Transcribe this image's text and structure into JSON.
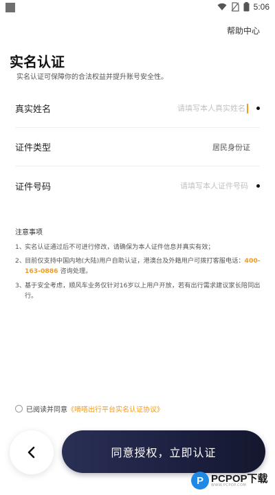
{
  "status_bar": {
    "time": "5:06"
  },
  "header": {
    "help": "帮助中心"
  },
  "page": {
    "title": "实名认证",
    "subtitle": "实名认证可保障你的合法权益并提升账号安全性。"
  },
  "form": {
    "name": {
      "label": "真实姓名",
      "placeholder": "请填写本人真实姓名",
      "value": ""
    },
    "id_type": {
      "label": "证件类型",
      "value": "居民身份证"
    },
    "id_number": {
      "label": "证件号码",
      "placeholder": "请填写本人证件号码",
      "value": ""
    }
  },
  "notice": {
    "title": "注意事项",
    "items": [
      {
        "num": "1、",
        "text": "实名认证通过后不可进行修改，请确保为本人证件信息并真实有效；"
      },
      {
        "num": "2、",
        "text_before": "目前仅支持中国内地(大陆)用户自助认证，港澳台及外籍用户可拨打客服电话：",
        "phone": "400-163-0886",
        "text_after": " 咨询处理。"
      },
      {
        "num": "3、",
        "text": "基于安全考虑，顺风车业务仅针对16岁以上用户开放，若有出行需求建议家长陪同出行。"
      }
    ]
  },
  "agreement": {
    "prefix": "已阅读并同意",
    "link": "《嘀嗒出行平台实名认证协议》",
    "checked": false
  },
  "actions": {
    "primary": "同意授权，立即认证"
  },
  "watermark": {
    "logo_letter": "P",
    "brand": "PCPOP下载",
    "sub": "WWW.PCPOP.COM"
  },
  "colors": {
    "accent": "#f39a1c",
    "button_dark": "#1c2040"
  }
}
